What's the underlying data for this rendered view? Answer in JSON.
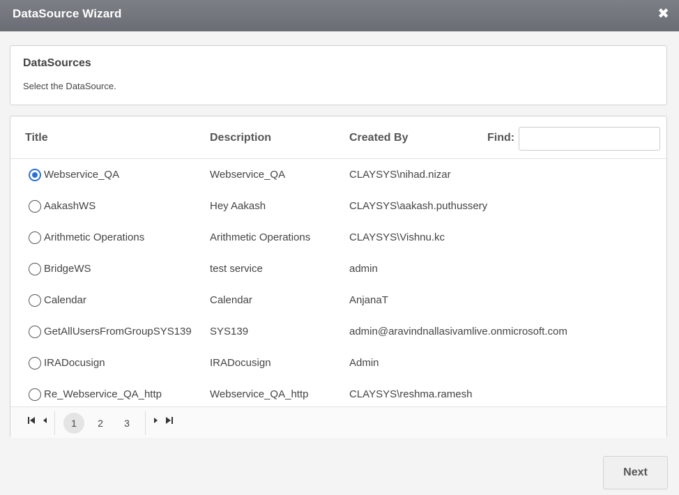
{
  "window": {
    "title": "DataSource Wizard",
    "close_icon": "close-icon"
  },
  "header": {
    "title": "DataSources",
    "subtitle": "Select the DataSource."
  },
  "grid": {
    "columns": {
      "title": "Title",
      "description": "Description",
      "created_by": "Created By"
    },
    "find": {
      "label": "Find:",
      "value": ""
    },
    "rows": [
      {
        "title": "Webservice_QA",
        "description": "Webservice_QA",
        "created_by": "CLAYSYS\\nihad.nizar",
        "selected": true
      },
      {
        "title": "AakashWS",
        "description": "Hey Aakash",
        "created_by": "CLAYSYS\\aakash.puthussery",
        "selected": false
      },
      {
        "title": "Arithmetic Operations",
        "description": "Arithmetic Operations",
        "created_by": "CLAYSYS\\Vishnu.kc",
        "selected": false
      },
      {
        "title": "BridgeWS",
        "description": "test service",
        "created_by": "admin",
        "selected": false
      },
      {
        "title": "Calendar",
        "description": "Calendar",
        "created_by": "AnjanaT",
        "selected": false
      },
      {
        "title": "GetAllUsersFromGroupSYS139",
        "description": "SYS139",
        "created_by": "admin@aravindnallasivamlive.onmicrosoft.com",
        "selected": false
      },
      {
        "title": "IRADocusign",
        "description": "IRADocusign",
        "created_by": "Admin",
        "selected": false
      },
      {
        "title": "Re_Webservice_QA_http",
        "description": "Webservice_QA_http",
        "created_by": "CLAYSYS\\reshma.ramesh",
        "selected": false
      }
    ]
  },
  "pager": {
    "pages": [
      "1",
      "2",
      "3"
    ],
    "current_page": "1",
    "icons": {
      "first": "first-page-icon",
      "prev": "prev-page-icon",
      "next": "next-page-icon",
      "last": "last-page-icon"
    }
  },
  "footer": {
    "next_label": "Next"
  },
  "colors": {
    "titlebar": "#70737a",
    "accent": "#2b6fd6"
  }
}
